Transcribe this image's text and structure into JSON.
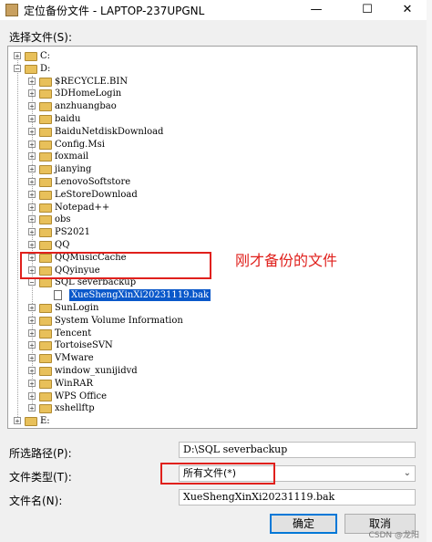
{
  "window": {
    "title": "定位备份文件 - LAPTOP-237UPGNL",
    "minimize": "—",
    "maximize": "☐",
    "close": "✕"
  },
  "tree": {
    "label": "选择文件(S):",
    "nodes": [
      {
        "level": 0,
        "expander": "+",
        "icon": "folder",
        "label": "C:"
      },
      {
        "level": 0,
        "expander": "−",
        "icon": "folder",
        "label": "D:"
      },
      {
        "level": 1,
        "expander": "+",
        "icon": "folder",
        "label": "$RECYCLE.BIN"
      },
      {
        "level": 1,
        "expander": "+",
        "icon": "folder",
        "label": "3DHomeLogin"
      },
      {
        "level": 1,
        "expander": "+",
        "icon": "folder",
        "label": "anzhuangbao"
      },
      {
        "level": 1,
        "expander": "+",
        "icon": "folder",
        "label": "baidu"
      },
      {
        "level": 1,
        "expander": "+",
        "icon": "folder",
        "label": "BaiduNetdiskDownload"
      },
      {
        "level": 1,
        "expander": "+",
        "icon": "folder",
        "label": "Config.Msi"
      },
      {
        "level": 1,
        "expander": "+",
        "icon": "folder",
        "label": "foxmail"
      },
      {
        "level": 1,
        "expander": "+",
        "icon": "folder",
        "label": "jianying"
      },
      {
        "level": 1,
        "expander": "+",
        "icon": "folder",
        "label": "LenovoSoftstore"
      },
      {
        "level": 1,
        "expander": "+",
        "icon": "folder",
        "label": "LeStoreDownload"
      },
      {
        "level": 1,
        "expander": "+",
        "icon": "folder",
        "label": "Notepad++"
      },
      {
        "level": 1,
        "expander": "+",
        "icon": "folder",
        "label": "obs"
      },
      {
        "level": 1,
        "expander": "+",
        "icon": "folder",
        "label": "PS2021"
      },
      {
        "level": 1,
        "expander": "+",
        "icon": "folder",
        "label": "QQ"
      },
      {
        "level": 1,
        "expander": "+",
        "icon": "folder",
        "label": "QQMusicCache"
      },
      {
        "level": 1,
        "expander": "+",
        "icon": "folder",
        "label": "QQyinyue"
      },
      {
        "level": 1,
        "expander": "−",
        "icon": "folder",
        "label": "SQL severbackup"
      },
      {
        "level": 2,
        "expander": "",
        "icon": "file",
        "label": "XueShengXinXi20231119.bak",
        "selected": true
      },
      {
        "level": 1,
        "expander": "+",
        "icon": "folder",
        "label": "SunLogin"
      },
      {
        "level": 1,
        "expander": "+",
        "icon": "folder",
        "label": "System Volume Information"
      },
      {
        "level": 1,
        "expander": "+",
        "icon": "folder",
        "label": "Tencent"
      },
      {
        "level": 1,
        "expander": "+",
        "icon": "folder",
        "label": "TortoiseSVN"
      },
      {
        "level": 1,
        "expander": "+",
        "icon": "folder",
        "label": "VMware"
      },
      {
        "level": 1,
        "expander": "+",
        "icon": "folder",
        "label": "window_xunijidvd"
      },
      {
        "level": 1,
        "expander": "+",
        "icon": "folder",
        "label": "WinRAR"
      },
      {
        "level": 1,
        "expander": "+",
        "icon": "folder",
        "label": "WPS Office"
      },
      {
        "level": 1,
        "expander": "+",
        "icon": "folder",
        "label": "xshellftp"
      },
      {
        "level": 0,
        "expander": "+",
        "icon": "folder",
        "label": "E:"
      }
    ]
  },
  "annotation": {
    "text": "刚才备份的文件"
  },
  "form": {
    "path_label": "所选路径(P):",
    "path_value": "D:\\SQL severbackup",
    "type_label": "文件类型(T):",
    "type_value": "所有文件(*)",
    "name_label": "文件名(N):",
    "name_value": "XueShengXinXi20231119.bak"
  },
  "buttons": {
    "ok": "确定",
    "cancel": "取消"
  },
  "watermark": "CSDN @龙阳"
}
